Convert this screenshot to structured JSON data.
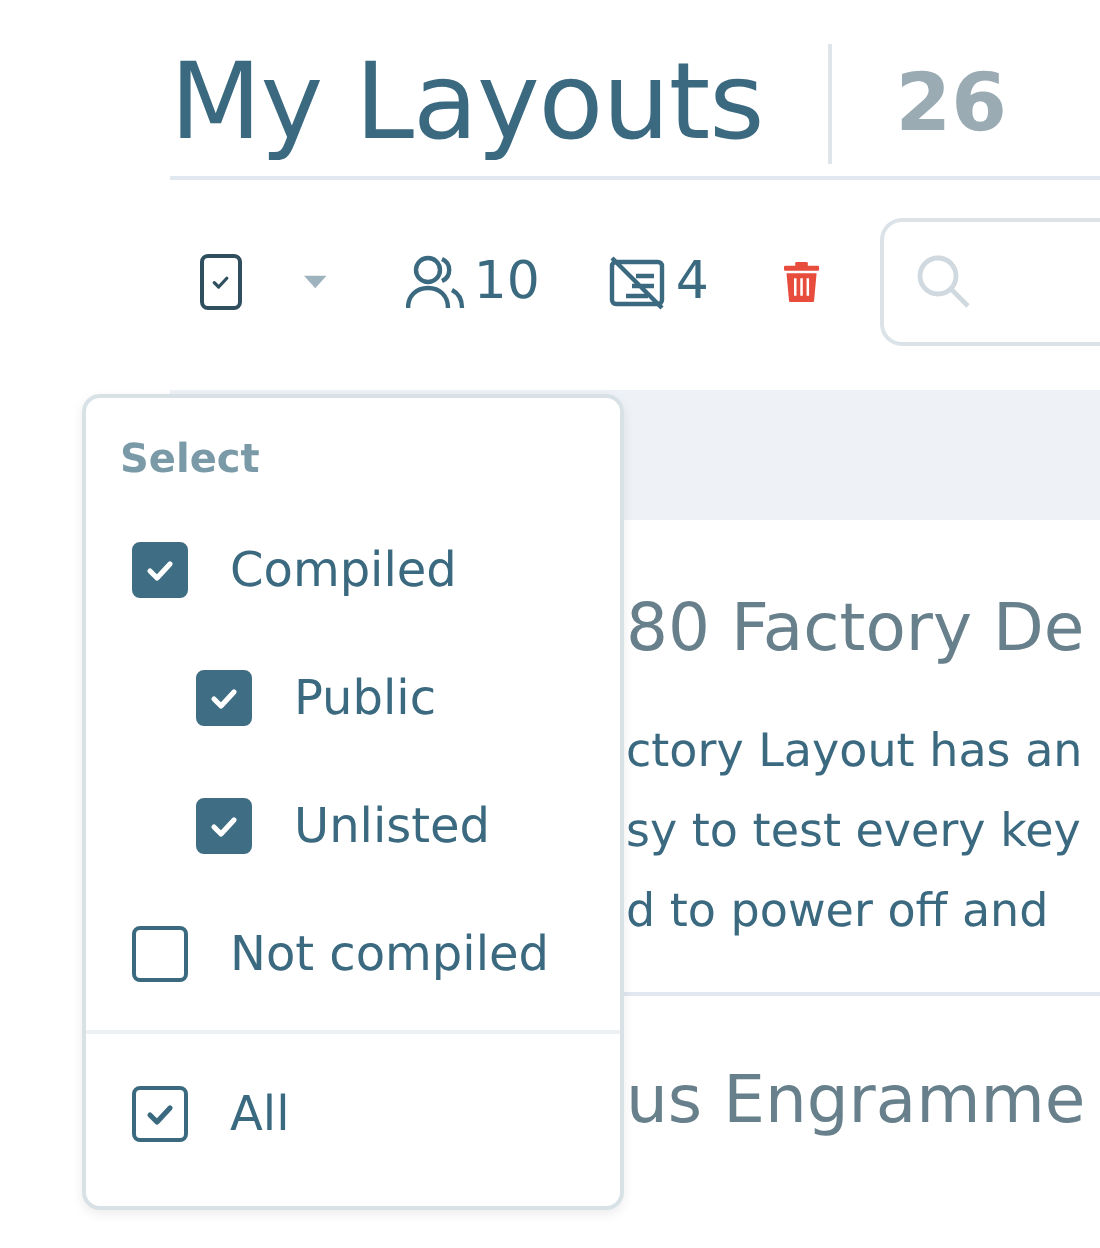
{
  "header": {
    "title": "My Layouts",
    "count": "26"
  },
  "toolbar": {
    "select_all_checked": true,
    "public_count": "10",
    "uncompiled_count": "4"
  },
  "layouts": [
    {
      "title": "80 Factory De",
      "description": [
        "ctory Layout has an",
        "sy to test every key",
        "d to power off and"
      ]
    },
    {
      "title": "us Engramme"
    }
  ],
  "select_menu": {
    "heading": "Select",
    "options": [
      {
        "label": "Compiled",
        "checked": true,
        "children": [
          {
            "label": "Public",
            "checked": true
          },
          {
            "label": "Unlisted",
            "checked": true
          }
        ]
      },
      {
        "label": "Not compiled",
        "checked": false
      }
    ],
    "all": {
      "label": "All",
      "checked": true
    }
  }
}
